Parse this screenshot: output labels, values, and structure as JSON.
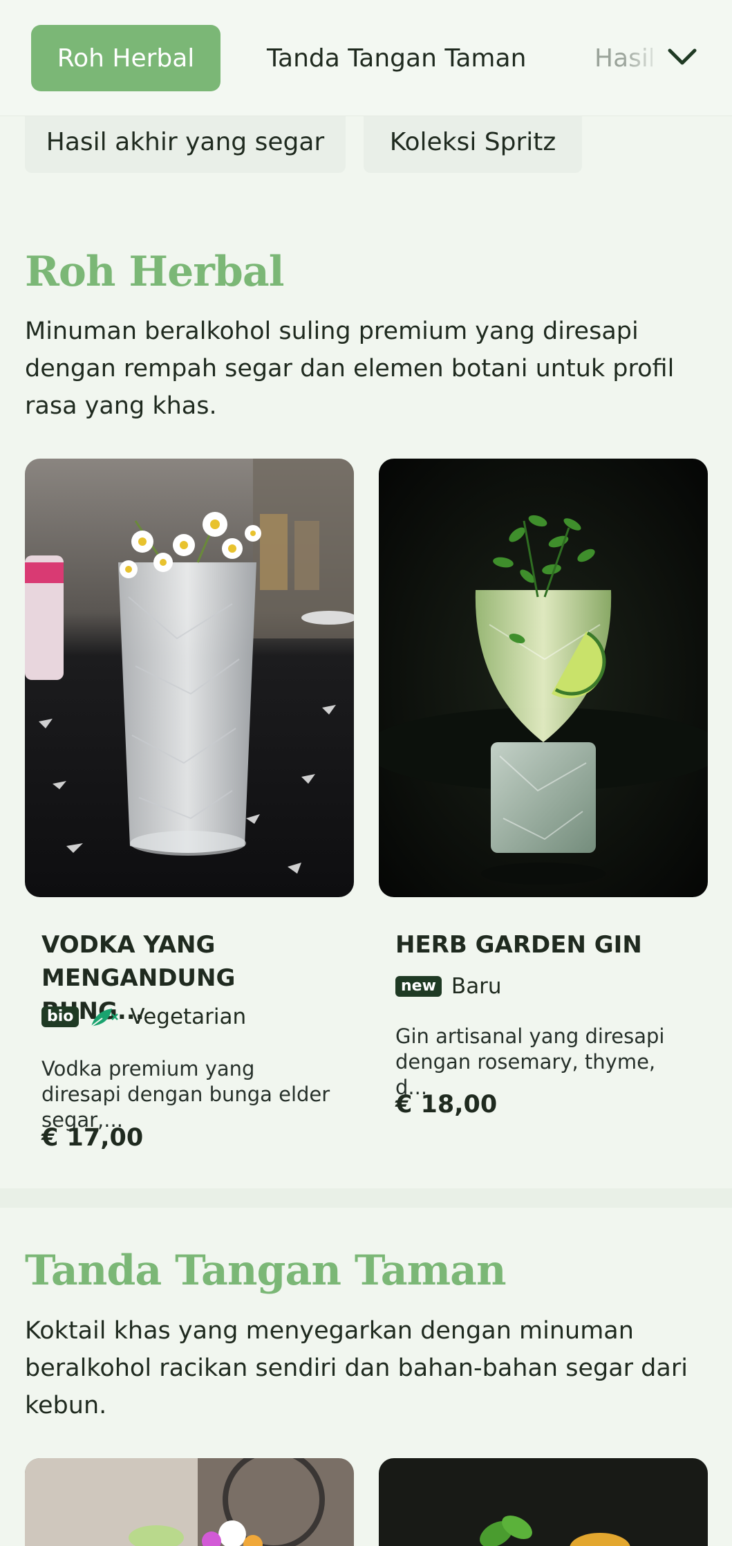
{
  "nav": {
    "tabs": [
      {
        "label": "Roh Herbal",
        "active": true
      },
      {
        "label": "Tanda Tangan Taman",
        "active": false
      },
      {
        "label": "Hasil",
        "active": false
      }
    ],
    "expand_icon": "chevron-down-icon"
  },
  "chips": [
    "Hasil akhir yang segar",
    "Koleksi Spritz"
  ],
  "sections": [
    {
      "title": "Roh Herbal",
      "description": "Minuman beralkohol suling premium yang diresapi dengan rempah segar dan elemen botani untuk profil rasa yang khas.",
      "products": [
        {
          "name": "VODKA YANG MENGANDUNG BUNG...",
          "badge_pill": "bio",
          "badge_icon": "vegetarian-leaf-icon",
          "badge_label": "Vegetarian",
          "description": "Vodka premium yang diresapi dengan bunga elder segar,...",
          "price": "€ 17,00"
        },
        {
          "name": "HERB GARDEN GIN",
          "badge_pill": "new",
          "badge_label": "Baru",
          "description": "Gin artisanal yang diresapi dengan rosemary, thyme, d...",
          "price": "€ 18,00"
        }
      ]
    },
    {
      "title": "Tanda Tangan Taman",
      "description": "Koktail khas yang menyegarkan dengan minuman beralkohol racikan sendiri dan bahan-bahan segar dari kebun."
    }
  ],
  "colors": {
    "accent": "#7bb776",
    "background": "#f1f6ef",
    "text": "#1f2a1f",
    "pill": "#1f3a24",
    "veg_icon": "#1aa36f"
  }
}
